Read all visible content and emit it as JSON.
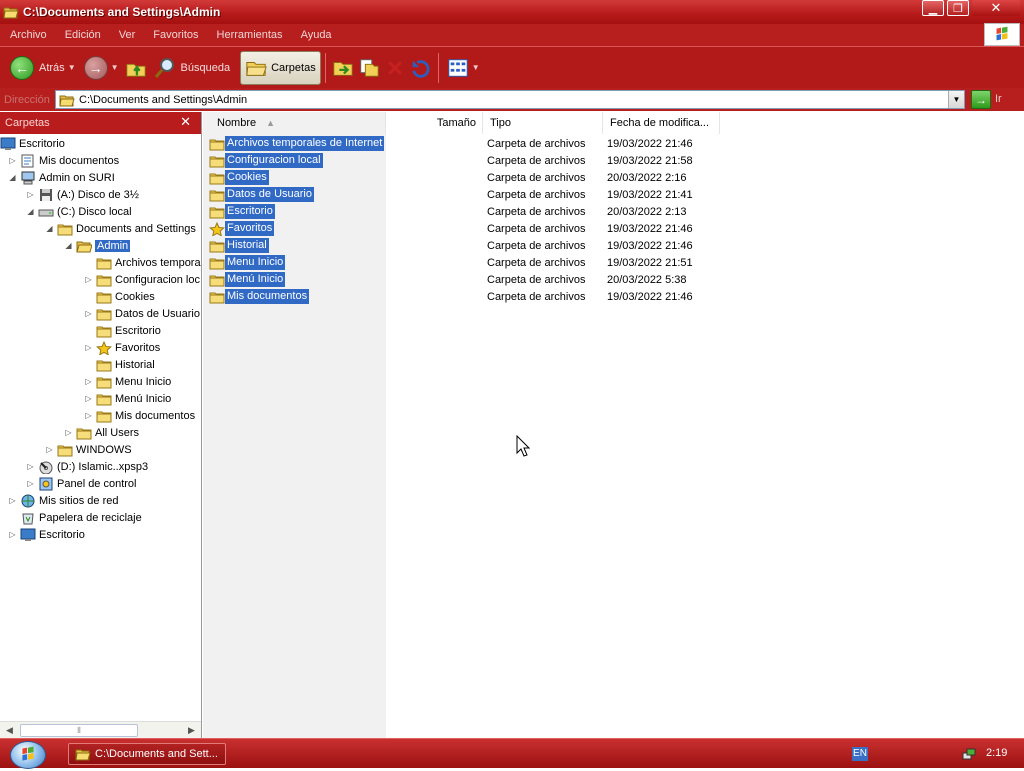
{
  "window": {
    "title": "C:\\Documents and Settings\\Admin",
    "buttons": {
      "minimize": "▁",
      "restore": "❐",
      "close": "✕"
    }
  },
  "menu": [
    "Archivo",
    "Edición",
    "Ver",
    "Favoritos",
    "Herramientas",
    "Ayuda"
  ],
  "toolbar": {
    "back_label": "Atrás",
    "search_label": "Búsqueda",
    "folders_label": "Carpetas"
  },
  "address": {
    "label": "Dirección",
    "value": "C:\\Documents and Settings\\Admin",
    "go_label": "Ir"
  },
  "folders_pane": {
    "title": "Carpetas",
    "tree": [
      {
        "label": "Escritorio",
        "icon": "desktop-icon",
        "expander": ""
      },
      {
        "label": "Mis documentos",
        "icon": "documents-icon",
        "expander": "▷"
      },
      {
        "label": "Admin on SURI",
        "icon": "computer-icon",
        "expander": "◢"
      },
      {
        "label": "(A:) Disco de 3½",
        "icon": "floppy-icon",
        "expander": "▷"
      },
      {
        "label": "(C:) Disco local",
        "icon": "harddisk-icon",
        "expander": "◢"
      },
      {
        "label": "Documents and Settings",
        "icon": "folder-icon",
        "expander": "◢"
      },
      {
        "label": "Admin",
        "icon": "folder-open-icon",
        "expander": "◢",
        "selected": true
      },
      {
        "label": "Archivos tempora",
        "icon": "folder-icon",
        "expander": ""
      },
      {
        "label": "Configuracion loc",
        "icon": "folder-icon",
        "expander": "▷"
      },
      {
        "label": "Cookies",
        "icon": "folder-icon",
        "expander": ""
      },
      {
        "label": "Datos de Usuario",
        "icon": "folder-icon",
        "expander": "▷"
      },
      {
        "label": "Escritorio",
        "icon": "folder-icon",
        "expander": ""
      },
      {
        "label": "Favoritos",
        "icon": "star-folder-icon",
        "expander": "▷"
      },
      {
        "label": "Historial",
        "icon": "folder-icon",
        "expander": ""
      },
      {
        "label": "Menu Inicio",
        "icon": "folder-icon",
        "expander": "▷"
      },
      {
        "label": "Menú Inicio",
        "icon": "folder-icon",
        "expander": "▷"
      },
      {
        "label": "Mis documentos",
        "icon": "folder-icon",
        "expander": "▷"
      },
      {
        "label": "All Users",
        "icon": "folder-icon",
        "expander": "▷"
      },
      {
        "label": "WINDOWS",
        "icon": "folder-icon",
        "expander": "▷"
      },
      {
        "label": "(D:) Islamic..xpsp3",
        "icon": "cd-icon",
        "expander": "▷"
      },
      {
        "label": "Panel de control",
        "icon": "control-panel-icon",
        "expander": "▷"
      },
      {
        "label": "Mis sitios de red",
        "icon": "network-icon",
        "expander": "▷"
      },
      {
        "label": "Papelera de reciclaje",
        "icon": "recycle-bin-icon",
        "expander": ""
      },
      {
        "label": "Escritorio",
        "icon": "desktop-icon",
        "expander": "▷"
      }
    ]
  },
  "columns": {
    "name": "Nombre",
    "size": "Tamaño",
    "type": "Tipo",
    "date": "Fecha de modifica..."
  },
  "files": [
    {
      "name": "Archivos temporales de Internet",
      "type": "Carpeta de archivos",
      "date": "19/03/2022 21:46",
      "icon": "folder-icon"
    },
    {
      "name": "Configuracion local",
      "type": "Carpeta de archivos",
      "date": "19/03/2022 21:58",
      "icon": "folder-icon"
    },
    {
      "name": "Cookies",
      "type": "Carpeta de archivos",
      "date": "20/03/2022 2:16",
      "icon": "folder-icon"
    },
    {
      "name": "Datos de Usuario",
      "type": "Carpeta de archivos",
      "date": "19/03/2022 21:41",
      "icon": "folder-icon"
    },
    {
      "name": "Escritorio",
      "type": "Carpeta de archivos",
      "date": "20/03/2022 2:13",
      "icon": "folder-icon"
    },
    {
      "name": "Favoritos",
      "type": "Carpeta de archivos",
      "date": "19/03/2022 21:46",
      "icon": "star-folder-icon"
    },
    {
      "name": "Historial",
      "type": "Carpeta de archivos",
      "date": "19/03/2022 21:46",
      "icon": "folder-icon"
    },
    {
      "name": "Menu Inicio",
      "type": "Carpeta de archivos",
      "date": "19/03/2022 21:51",
      "icon": "folder-icon"
    },
    {
      "name": "Menú Inicio",
      "type": "Carpeta de archivos",
      "date": "20/03/2022 5:38",
      "icon": "folder-icon"
    },
    {
      "name": "Mis documentos",
      "type": "Carpeta de archivos",
      "date": "19/03/2022 21:46",
      "icon": "folder-icon"
    }
  ],
  "taskbar": {
    "task_label": "C:\\Documents and Sett...",
    "language": "EN",
    "clock": "2:19"
  }
}
